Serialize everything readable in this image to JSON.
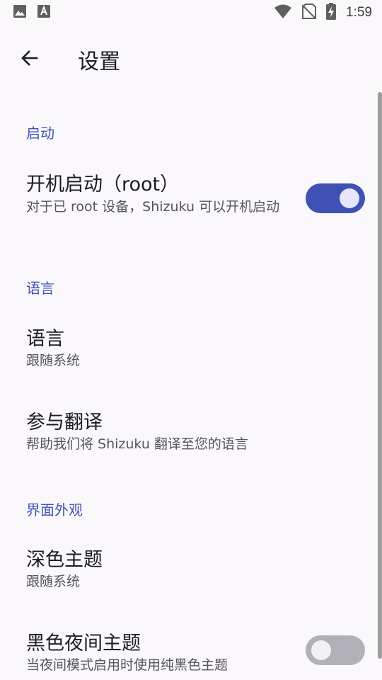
{
  "status_bar": {
    "time": "1:59",
    "icons": [
      "image-icon",
      "font-icon",
      "wifi-icon",
      "no-sim-icon",
      "battery-charging-icon"
    ]
  },
  "app_bar": {
    "title": "设置"
  },
  "sections": {
    "startup": {
      "header": "启动",
      "boot_start": {
        "title": "开机启动（root）",
        "summary": "对于已 root 设备，Shizuku 可以开机启动",
        "enabled": true
      }
    },
    "language": {
      "header": "语言",
      "language_pref": {
        "title": "语言",
        "summary": "跟随系统"
      },
      "translate_pref": {
        "title": "参与翻译",
        "summary": "帮助我们将 Shizuku 翻译至您的语言"
      }
    },
    "appearance": {
      "header": "界面外观",
      "dark_theme": {
        "title": "深色主题",
        "summary": "跟随系统"
      },
      "black_night_theme": {
        "title": "黑色夜间主题",
        "summary": "当夜间模式启用时使用纯黑色主题",
        "enabled": false
      }
    }
  },
  "colors": {
    "accent": "#3f51b5",
    "background": "#fbf8fc"
  }
}
